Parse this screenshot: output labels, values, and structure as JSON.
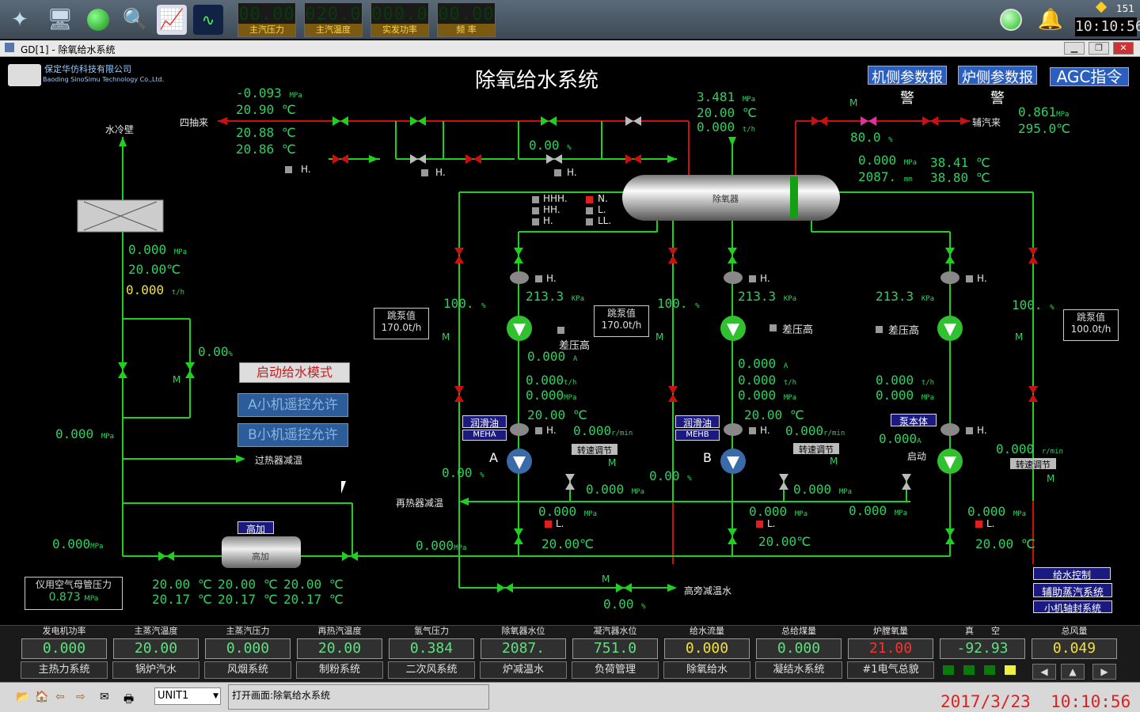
{
  "toolbar": {
    "lcds": [
      {
        "value": "00.00",
        "label": "主汽压力"
      },
      {
        "value": "020.0",
        "label": "主汽温度"
      },
      {
        "value": "000.0",
        "label": "实发功率"
      },
      {
        "value": "00.00",
        "label": "频 率"
      }
    ],
    "counter": "151",
    "clock": "10:10:56"
  },
  "window": {
    "title": "GD[1] - 除氧给水系统"
  },
  "header": {
    "company": "保定华仿科技有限公司",
    "company_en": "Baoding SinoSimu Technology Co.,Ltd.",
    "page_title": "除氧给水系统",
    "buttons": [
      "机侧参数报警",
      "炉侧参数报警",
      "AGC指令"
    ]
  },
  "labels": {
    "sichou": "四抽来",
    "shuileng": "水冷壁",
    "fuqi": "辅汽来",
    "deaerator": "除氧器",
    "guoreqi": "过热器减温",
    "zaireqi": "再热器减温",
    "gaopang": "高旁减温水",
    "gaojia": "高加",
    "gaojia_tag": "高加",
    "yiqi_title": "仪用空气母管压力",
    "yiqi_value": "0.873",
    "yiqi_unit": "MPa",
    "pumpA": "A",
    "pumpB": "B",
    "qidong": "启动",
    "chayagao": "差压高",
    "runhuayou": "润滑油",
    "bengti": "泵本体",
    "meha": "MEHA",
    "mehb": "MEHB",
    "zhuansu": "转速调节",
    "tiaobeng": "跳泵值",
    "M": "M",
    "H": "H.",
    "L": "L.",
    "HHH": "HHH.",
    "HH": "HH.",
    "N": "N.",
    "LL": "LL."
  },
  "modes": {
    "start_feed": "启动给水模式",
    "a_remote": "A小机遥控允许",
    "b_remote": "B小机遥控允许"
  },
  "values": {
    "v_sichou_p": "-0.093",
    "v_sichou_t": "20.90",
    "v_t1": "20.88",
    "v_t2": "20.86",
    "v_mid_pct": "0.00",
    "v_de_p": "3.481",
    "v_de_t": "20.00",
    "v_de_f": "0.000",
    "v_fuqi_p": "0.861",
    "v_fuqi_t": "295.0",
    "v_valve_pct": "80.0",
    "v_de_pr": "0.000",
    "v_de_lvl": "2087.",
    "v_de_t1": "38.41",
    "v_de_t2": "38.80",
    "v_cool_p": "0.000",
    "v_cool_t": "20.00",
    "v_cool_f": "0.000",
    "v_bypass_pct": "0.00",
    "v_left_p": "0.000",
    "v_left_p2": "0.000",
    "pA_tiao": "170.0",
    "pB_tiao": "170.0",
    "pC_tiao": "100.0",
    "pA_pct": "100.",
    "pB_pct": "100.",
    "pC_pct": "100.",
    "pA_kpa": "213.3",
    "pB_kpa": "213.3",
    "pC_kpa": "213.3",
    "pA_amp": "0.000",
    "pA_flow": "0.000",
    "pA_mpa": "0.000",
    "pA_temp": "20.00",
    "pA_rpm": "0.000",
    "pB_amp": "0.000",
    "pB_flow": "0.000",
    "pB_mpa": "0.000",
    "pB_temp": "20.00",
    "pB_rpm": "0.000",
    "pC_flow": "0.000",
    "pC_mpa": "0.000",
    "pC_amp": "0.000",
    "pC_rpm": "0.000",
    "pA_rec": "0.00",
    "pB_rec": "0.00",
    "pA_out": "0.000",
    "pB_out": "0.000",
    "pC_out": "0.000",
    "pA_dp": "0.000",
    "pB_dp": "0.000",
    "pC_dp": "0.000",
    "pA_t2": "20.00",
    "pB_t2": "20.00",
    "pC_t2": "20.00",
    "v_main": "0.000",
    "v_gaopang": "0.00",
    "hx_t": [
      "20.00",
      "20.00",
      "20.00"
    ],
    "hx_t2": [
      "20.17",
      "20.17",
      "20.17"
    ]
  },
  "units": {
    "mpa": "MPa",
    "c": "℃",
    "th": "t/h",
    "pct": "%",
    "kpa": "KPa",
    "rmin": "r/min",
    "mm": "mm",
    "amp": "A"
  },
  "side_buttons": [
    "给水控制",
    "辅助蒸汽系统",
    "小机轴封系统"
  ],
  "bottom": {
    "columns": [
      {
        "h": "发电机功率",
        "v": "0.000",
        "b": "主热力系统",
        "color": "#60e080"
      },
      {
        "h": "主蒸汽温度",
        "v": "20.00",
        "b": "锅炉汽水",
        "color": "#60e080"
      },
      {
        "h": "主蒸汽压力",
        "v": "0.000",
        "b": "风烟系统",
        "color": "#60e080"
      },
      {
        "h": "再热汽温度",
        "v": "20.00",
        "b": "制粉系统",
        "color": "#60e080"
      },
      {
        "h": "氢气压力",
        "v": "0.384",
        "b": "二次风系统",
        "color": "#60e080"
      },
      {
        "h": "除氧器水位",
        "v": "2087.",
        "b": "炉减温水",
        "color": "#60e080"
      },
      {
        "h": "凝汽器水位",
        "v": "751.0",
        "b": "负荷管理",
        "color": "#60e080"
      },
      {
        "h": "给水流量",
        "v": "0.000",
        "b": "除氧给水",
        "color": "#f0e040"
      },
      {
        "h": "总给煤量",
        "v": "0.000",
        "b": "凝结水系统",
        "color": "#60e080"
      },
      {
        "h": "炉膛氧量",
        "v": "21.00",
        "b": "#1电气总貌",
        "color": "#ff3030"
      },
      {
        "h": "真　　空",
        "v": "-92.93",
        "b": "",
        "color": "#60e080"
      },
      {
        "h": "总风量",
        "v": "0.049",
        "b": "",
        "color": "#f0e040"
      }
    ]
  },
  "status": {
    "unit_select": "UNIT1",
    "message": "打开画面:除氧给水系统",
    "datetime": "2017/3/23  10:10:56"
  }
}
